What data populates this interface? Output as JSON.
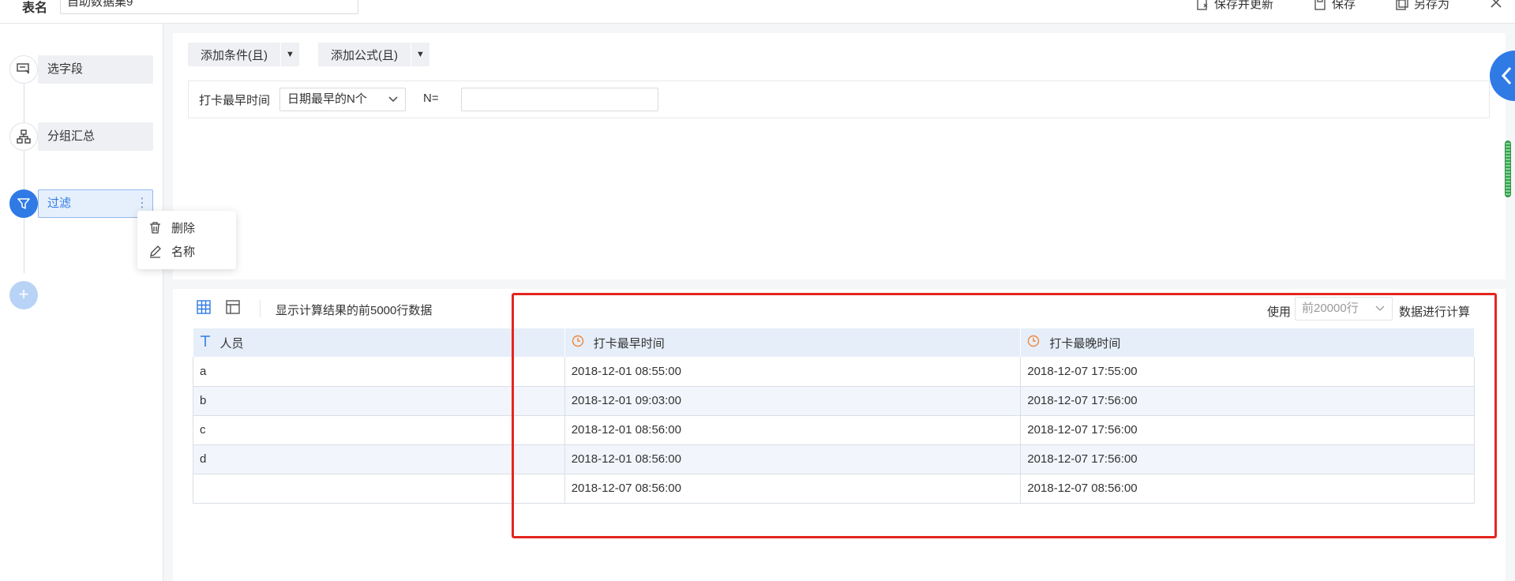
{
  "topbar": {
    "table_name_label": "表名",
    "table_name_value": "自助数据集9",
    "actions": {
      "save_update": "保存并更新",
      "save": "保存",
      "save_as": "另存为"
    }
  },
  "sidebar": {
    "steps": [
      {
        "label": "选字段",
        "icon": "select-field-icon"
      },
      {
        "label": "分组汇总",
        "icon": "group-summary-icon"
      },
      {
        "label": "过滤",
        "icon": "filter-icon"
      }
    ],
    "add_label": "+",
    "context_menu": {
      "delete": "删除",
      "rename": "名称"
    }
  },
  "condition": {
    "add_condition": "添加条件(且)",
    "add_formula": "添加公式(且)",
    "field_name": "打卡最早时间",
    "operator": "日期最早的N个",
    "n_label": "N=",
    "n_value": ""
  },
  "result": {
    "info": "显示计算结果的前5000行数据",
    "use_label": "使用",
    "rows_option": "前20000行",
    "calc_label": "数据进行计算",
    "columns": [
      {
        "label": "人员",
        "type_icon": "text-type-icon"
      },
      {
        "label": "打卡最早时间",
        "type_icon": "clock-icon"
      },
      {
        "label": "打卡最晚时间",
        "type_icon": "clock-icon"
      }
    ],
    "rows": [
      [
        "a",
        "2018-12-01 08:55:00",
        "2018-12-07 17:55:00"
      ],
      [
        "b",
        "2018-12-01 09:03:00",
        "2018-12-07 17:56:00"
      ],
      [
        "c",
        "2018-12-01 08:56:00",
        "2018-12-07 17:56:00"
      ],
      [
        "d",
        "2018-12-01 08:56:00",
        "2018-12-07 17:56:00"
      ],
      [
        "",
        "2018-12-07 08:56:00",
        "2018-12-07 08:56:00"
      ]
    ]
  },
  "colors": {
    "accent": "#2f7ae5",
    "highlight_border": "#e4261e",
    "time_icon": "#f0883a"
  }
}
